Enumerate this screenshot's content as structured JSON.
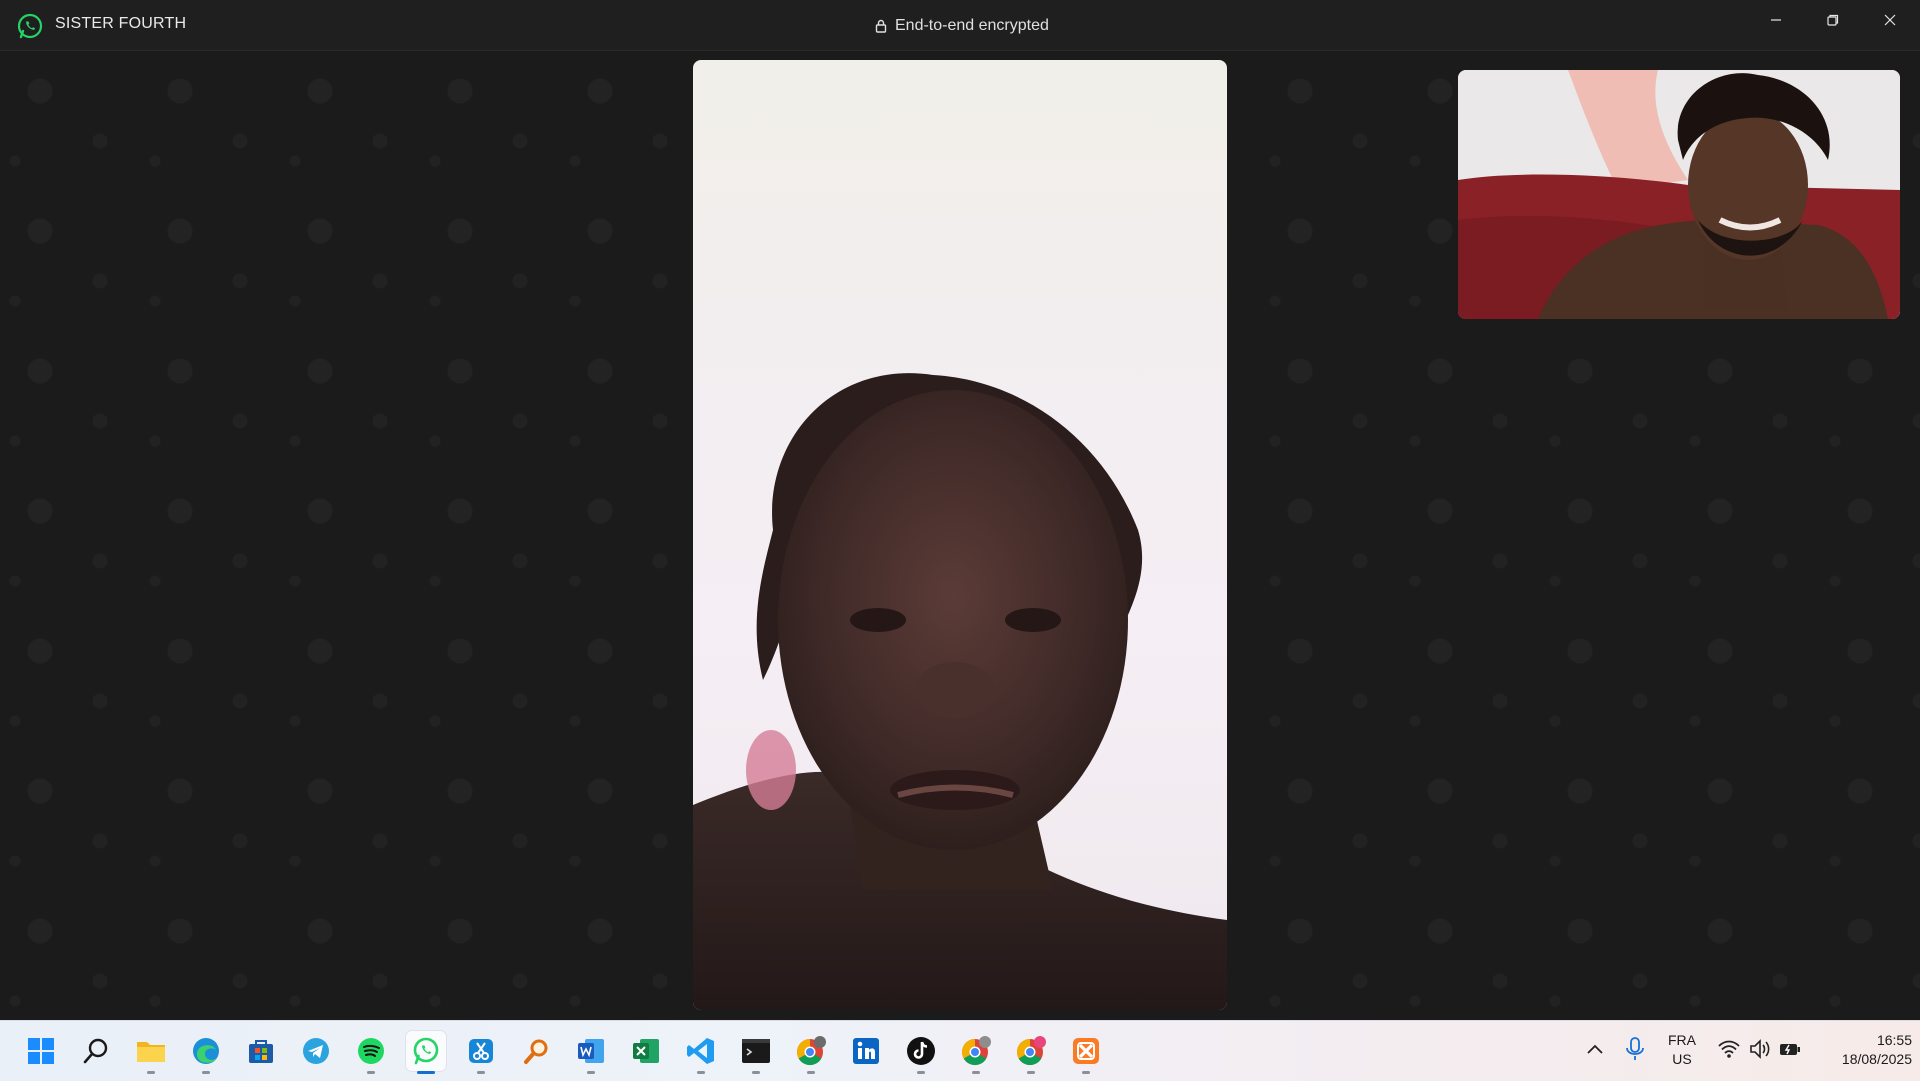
{
  "window": {
    "contact_name": "SISTER FOURTH",
    "encryption_label": "End-to-end encrypted",
    "controls": [
      "minimize-icon",
      "restore-icon",
      "close-icon"
    ]
  },
  "call": {
    "remote_video": "remote-participant-video",
    "self_video": "self-preview-video"
  },
  "taskbar": {
    "apps": [
      "windows-start",
      "search",
      "file-explorer",
      "edge",
      "microsoft-store",
      "telegram",
      "spotify",
      "whatsapp",
      "snipping-tool",
      "search-everything",
      "word",
      "excel",
      "vscode",
      "terminal",
      "chrome-profile",
      "linkedin",
      "tiktok",
      "chrome-profile-r",
      "chrome-profile-j",
      "xampp"
    ],
    "active_app": "whatsapp",
    "language_line1": "FRA",
    "language_line2": "US",
    "time": "16:55",
    "date": "18/08/2025"
  },
  "colors": {
    "whatsapp_green": "#25d366",
    "titlebar": "#1f1f1f",
    "call_bg": "#1b1b1b",
    "taskbar_active": "#1170cf"
  }
}
